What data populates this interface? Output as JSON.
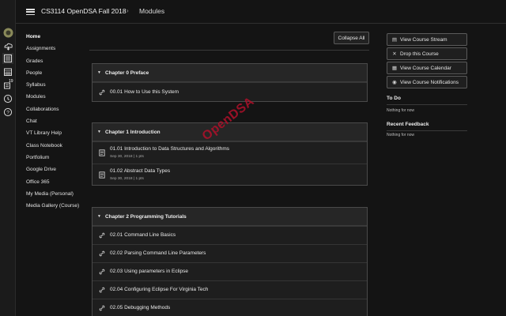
{
  "header": {
    "course": "CS3114 OpenDSA Fall 2018",
    "separator": "›",
    "page": "Modules"
  },
  "rail_icons": [
    "logo-icon",
    "account-icon",
    "dashboard-icon",
    "courses-icon",
    "calendar-icon",
    "inbox-icon",
    "history-icon",
    "help-icon"
  ],
  "rail_badge": "19",
  "course_nav": [
    {
      "label": "Home",
      "active": true
    },
    {
      "label": "Assignments"
    },
    {
      "label": "Grades"
    },
    {
      "label": "People"
    },
    {
      "label": "Syllabus"
    },
    {
      "label": "Modules"
    },
    {
      "label": "Collaborations"
    },
    {
      "label": "Chat"
    },
    {
      "label": "VT Library Help"
    },
    {
      "label": "Class Notebook"
    },
    {
      "label": "Portfolium"
    },
    {
      "label": "Google Drive"
    },
    {
      "label": "Office 365"
    },
    {
      "label": "My Media (Personal)"
    },
    {
      "label": "Media Gallery (Course)"
    }
  ],
  "collapse_all": "Collapse All",
  "modules": [
    {
      "title": "Chapter 0 Preface",
      "items": [
        {
          "title": "00.01 How to Use this System",
          "icon": "link-icon"
        }
      ]
    },
    {
      "title": "Chapter 1 Introduction",
      "items": [
        {
          "title": "01.01 Introduction to Data Structures and Algorithms",
          "meta": "Sep 30, 2018 | 1 pts",
          "icon": "assignment-icon"
        },
        {
          "title": "01.02 Abstract Data Types",
          "meta": "Sep 30, 2018 | 1 pts",
          "icon": "assignment-icon"
        }
      ]
    },
    {
      "title": "Chapter 2 Programming Tutorials",
      "items": [
        {
          "title": "02.01 Command Line Basics",
          "icon": "link-icon"
        },
        {
          "title": "02.02 Parsing Command Line Parameters",
          "icon": "link-icon"
        },
        {
          "title": "02.03 Using parameters in Eclipse",
          "icon": "link-icon"
        },
        {
          "title": "02.04 Configuring Eclipse For Virginia Tech",
          "icon": "link-icon"
        },
        {
          "title": "02.05 Debugging Methods",
          "icon": "link-icon"
        }
      ]
    }
  ],
  "sidebar": {
    "buttons": [
      {
        "label": "View Course Stream",
        "icon": "stream-icon"
      },
      {
        "label": "Drop this Course",
        "icon": "close-icon"
      },
      {
        "label": "View Course Calendar",
        "icon": "calendar-icon"
      },
      {
        "label": "View Course Notifications",
        "icon": "notification-icon"
      }
    ],
    "todo_heading": "To Do",
    "todo_note": "Nothing for now",
    "feedback_heading": "Recent Feedback",
    "feedback_note": "Nothing for now"
  },
  "watermark": "OpenDSA"
}
